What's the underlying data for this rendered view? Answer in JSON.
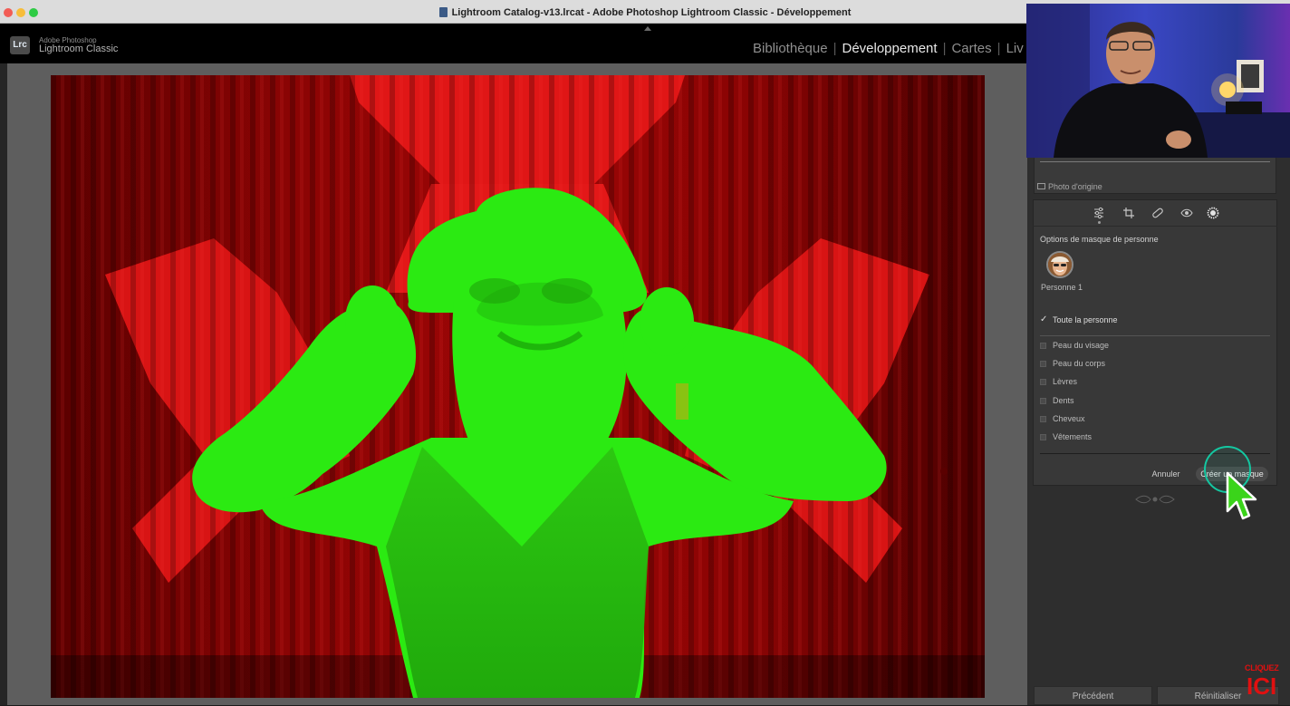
{
  "window": {
    "title": "Lightroom Catalog-v13.lrcat - Adobe Photoshop Lightroom Classic - Développement"
  },
  "brand": {
    "logo": "Lrc",
    "line1": "Adobe Photoshop",
    "line2": "Lightroom Classic"
  },
  "modules": [
    {
      "label": "Bibliothèque",
      "active": false
    },
    {
      "label": "Développement",
      "active": true
    },
    {
      "label": "Cartes",
      "active": false
    },
    {
      "label": "Liv",
      "active": false
    }
  ],
  "histogram": {
    "original_label": "Photo d'origine"
  },
  "toolbar": {
    "icons": [
      "sliders-icon",
      "crop-icon",
      "bandage-icon",
      "eye-icon",
      "mask-circle-icon"
    ]
  },
  "mask_panel": {
    "title": "Options de masque de personne",
    "person_label": "Personne 1",
    "whole_person": "Toute la personne",
    "options": [
      "Peau du visage",
      "Peau du corps",
      "Lèvres",
      "Dents",
      "Cheveux",
      "Vêtements"
    ],
    "cancel_label": "Annuler",
    "create_label": "Créer un masque"
  },
  "footer": {
    "previous_label": "Précédent",
    "reset_label": "Réinitialiser"
  },
  "overlay": {
    "cliquez": "CLIQUEZ",
    "ici": "ICI"
  },
  "colors": {
    "mask_green": "#2bea12",
    "curtain_red": "#d11414",
    "accent_ring": "#14c7a1",
    "cursor_green": "#3ad41a"
  }
}
